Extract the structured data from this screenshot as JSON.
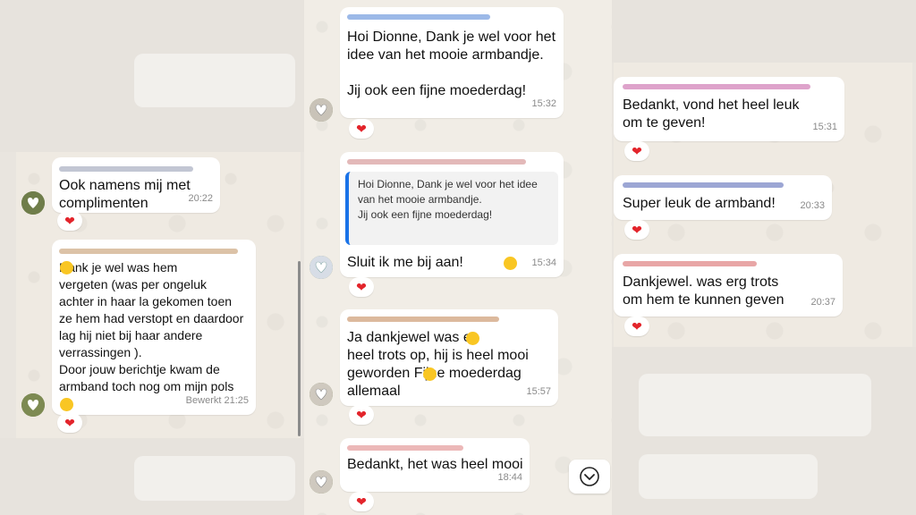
{
  "colors": {
    "reaction": "#e3242b",
    "quote_bar": "#1a73e8",
    "bubble": "#ffffff"
  },
  "left": {
    "messages": [
      {
        "text": "Ook namens mij met\ncomplimenten",
        "time": "20:22",
        "reaction": "❤"
      },
      {
        "text": "Dank je wel  was hem\nvergeten  (was per ongeluk\nachter in haar la gekomen toen\nze hem had verstopt en daardoor\nlag hij niet bij haar andere\nverrassingen ).\nDoor jouw berichtje kwam de\narmband toch nog om mijn pols\n",
        "time": "Bewerkt 21:25",
        "reaction": "❤"
      }
    ]
  },
  "middle": {
    "messages": [
      {
        "text": "Hoi Dionne, Dank je wel voor het\nidee van het mooie armbandje.\n\nJij ook een fijne moederdag!",
        "time": "15:32",
        "reaction": "❤"
      },
      {
        "quote": "Hoi Dionne, Dank je wel voor het idee\nvan het mooie armbandje.\nJij ook een fijne moederdag!",
        "text": "Sluit ik me bij aan! ",
        "time": "15:34",
        "reaction": "❤"
      },
      {
        "text": "Ja dankjewel  was er\nheel trots op, hij is heel mooi\ngeworden   Fijne moederdag\nallemaal",
        "time": "15:57",
        "reaction": "❤"
      },
      {
        "text": "Bedankt, het was heel mooi",
        "time": "18:44",
        "reaction": "❤"
      }
    ]
  },
  "right": {
    "messages": [
      {
        "text": "Bedankt,  vond het heel leuk\nom te geven!",
        "time": "15:31",
        "reaction": "❤"
      },
      {
        "text": "Super leuk de armband!",
        "time": "20:33",
        "reaction": "❤"
      },
      {
        "text": "Dankjewel.  was erg trots\nom hem te kunnen geven",
        "time": "20:37",
        "reaction": "❤"
      }
    ]
  },
  "scroll_down_icon": "chevron-down-icon"
}
